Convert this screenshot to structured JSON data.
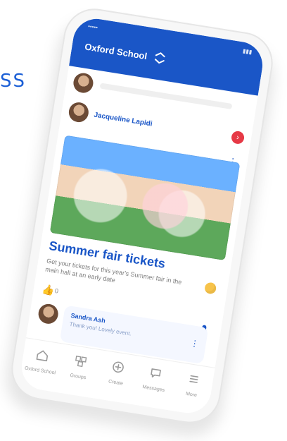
{
  "side_text": "SS",
  "app": {
    "school_name": "Oxford School"
  },
  "post": {
    "author": "Jacqueline Lapidi",
    "title": "Summer fair tickets",
    "description": "Get your tickets for this year's Summer fair in the main hall at an early date",
    "likes": "0"
  },
  "comment": {
    "author": "Sandra Ash",
    "text": "Thank you! Lovely event."
  },
  "icons": {
    "switch": "switch-icon",
    "home": "home-icon",
    "groups": "groups-icon",
    "create": "create-icon",
    "messages": "messages-icon",
    "menu": "menu-icon",
    "bell": "bell-icon",
    "like": "thumbs-up-icon",
    "emoji": "emoji-icon"
  },
  "nav": {
    "items": [
      {
        "label": "Oxford School"
      },
      {
        "label": "Groups"
      },
      {
        "label": "Create"
      },
      {
        "label": "Messages"
      },
      {
        "label": "More"
      }
    ]
  },
  "colors": {
    "primary": "#1a56c7",
    "accent_red": "#e63946"
  }
}
